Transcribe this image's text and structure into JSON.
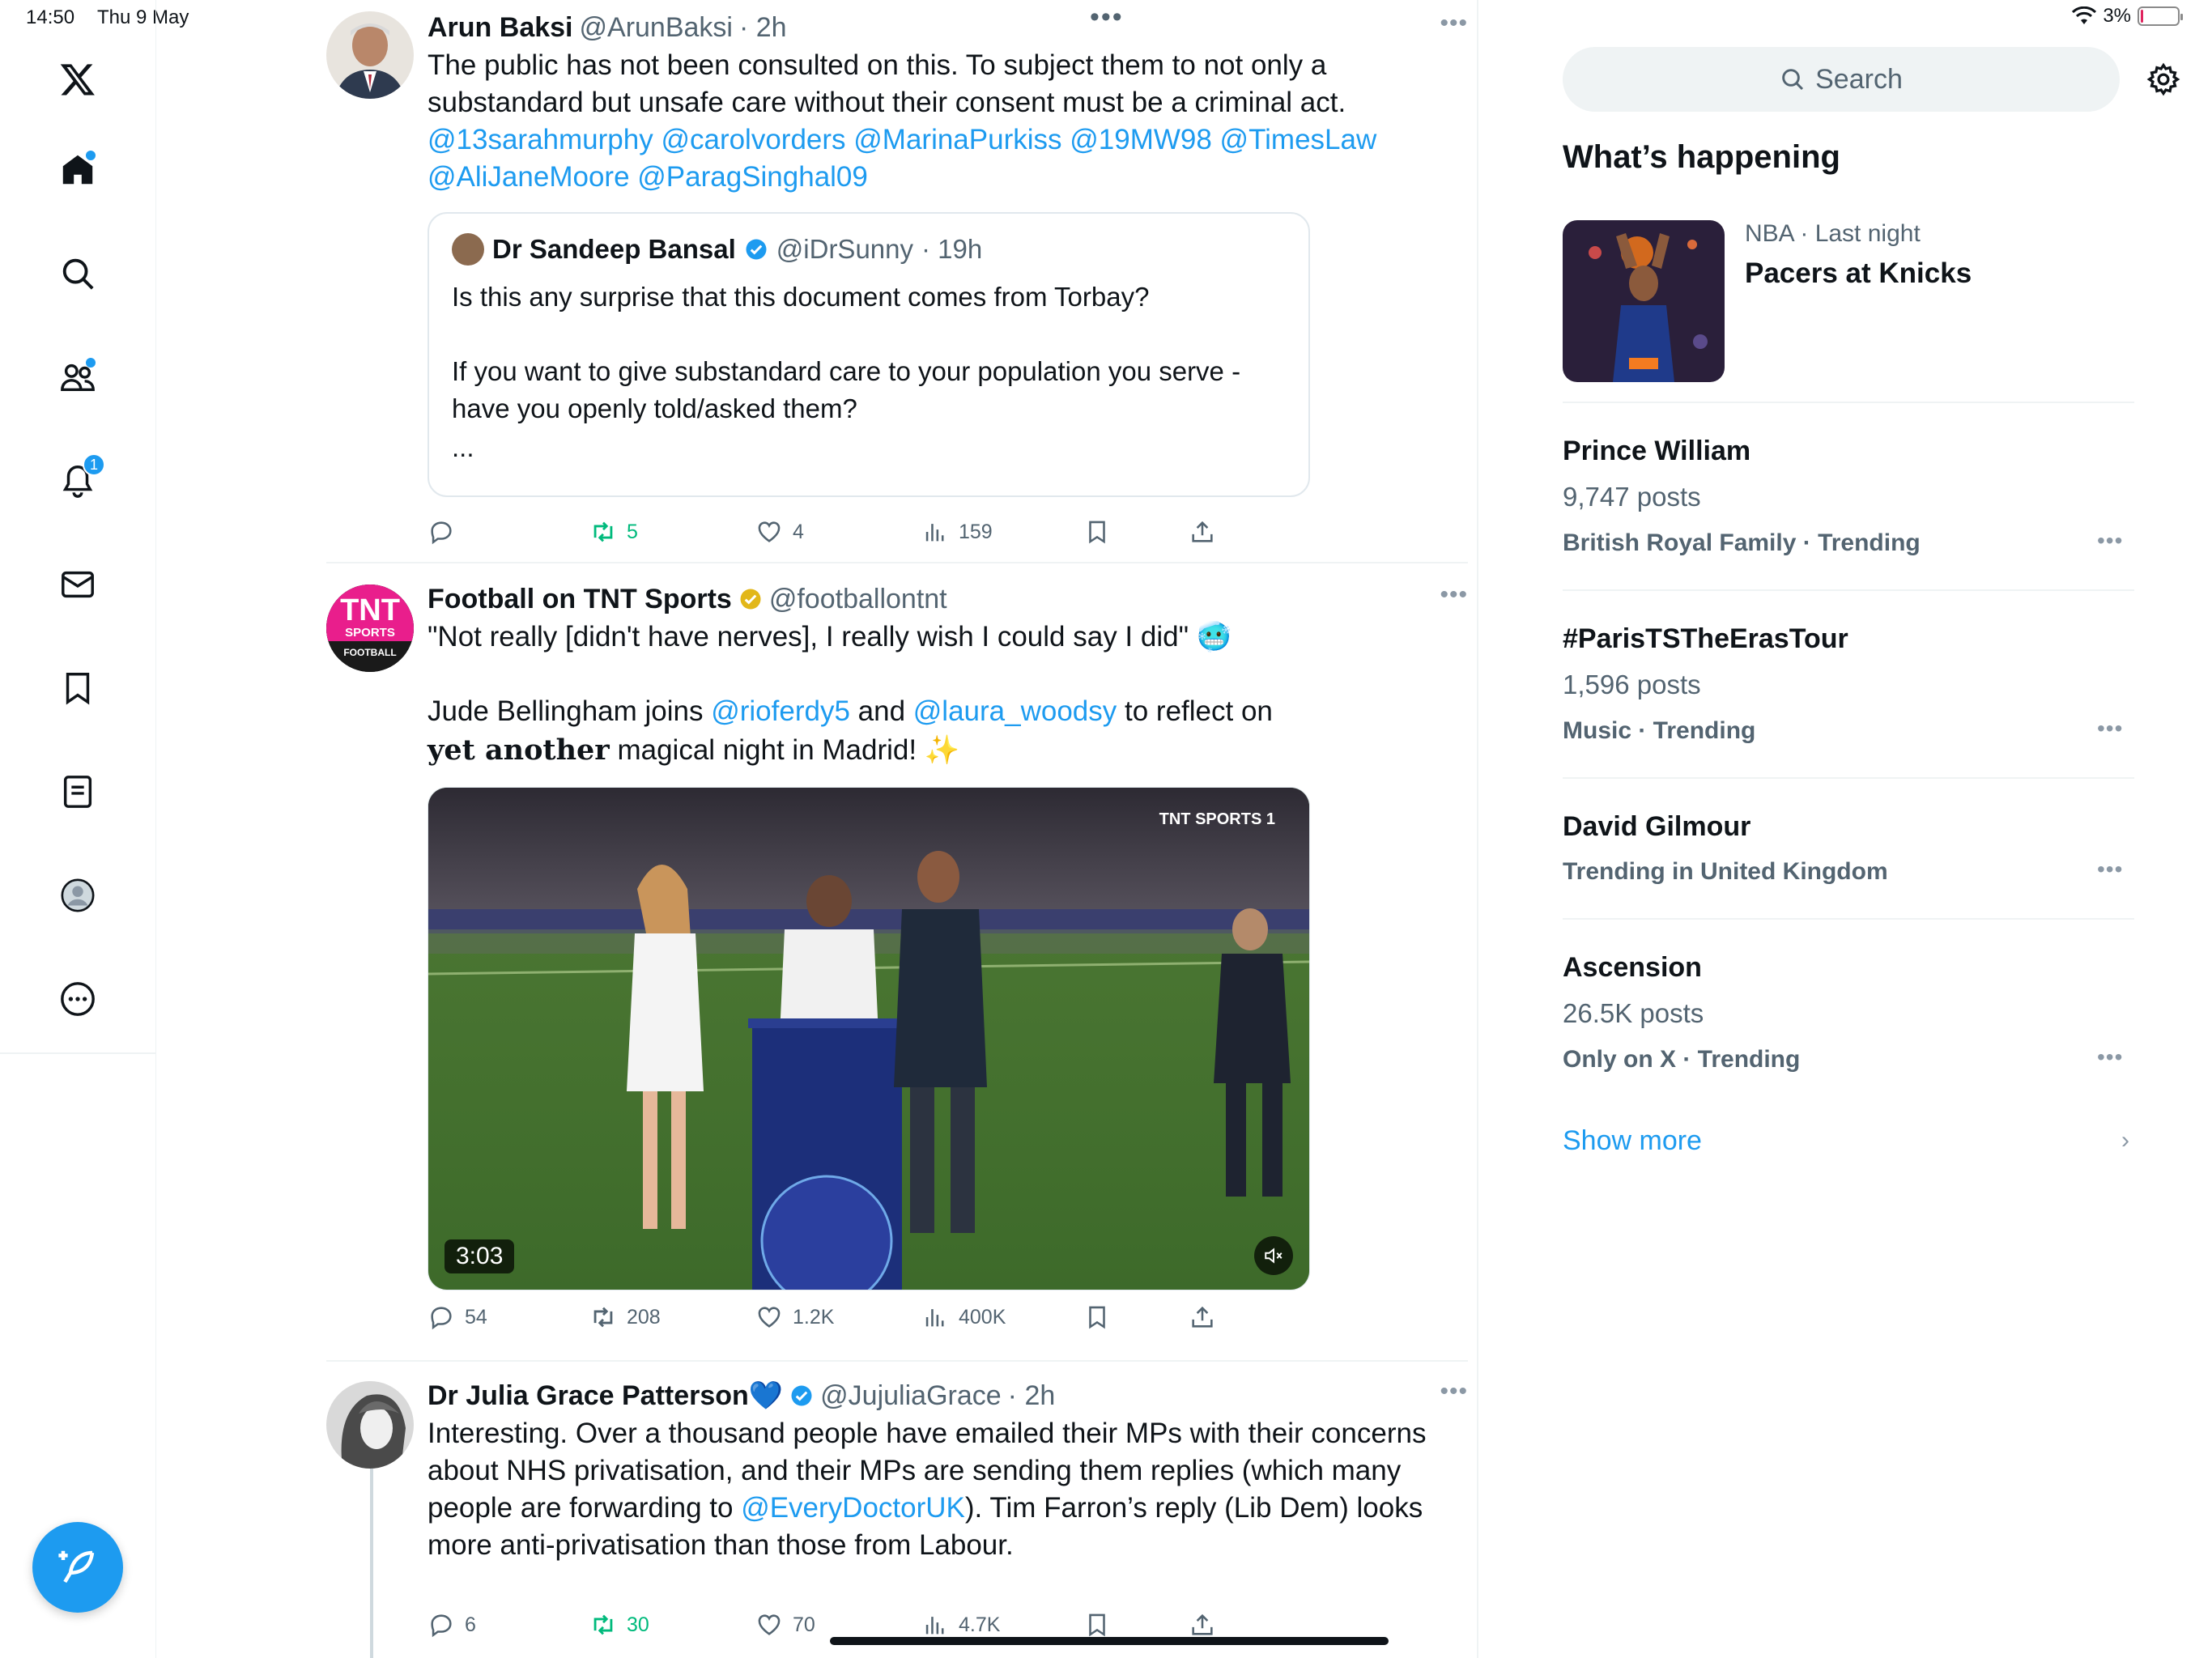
{
  "status": {
    "time": "14:50",
    "date": "Thu 9 May",
    "battery": "3%",
    "battery_level": 0.03
  },
  "nav": {
    "notifications_badge": "1"
  },
  "feed": {
    "tweets": [
      {
        "name": "Arun Baksi",
        "handle": "@ArunBaksi",
        "time": "· 2h",
        "text": "The public has not been consulted on this. To subject them to not only a substandard but unsafe care without their consent must be a criminal act.",
        "mentions": "@13sarahmurphy @carolvorders @MarinaPurkiss @19MW98 @TimesLaw @AliJaneMoore @ParagSinghal09",
        "quote": {
          "name": "Dr Sandeep Bansal",
          "handle": "@iDrSunny",
          "time": "· 19h",
          "line1": "Is this any surprise that this document comes from Torbay?",
          "line2": "If you want to give substandard care to your population you serve - have you openly told/asked them?",
          "line3": "..."
        },
        "replies": "",
        "retweets": "5",
        "likes": "4",
        "views": "159"
      },
      {
        "name": "Football on TNT Sports",
        "handle": "@footballontnt",
        "line1": "\"Not really [didn't have nerves], I really wish I could say I did\" 🥶",
        "line2_a": "Jude Bellingham joins ",
        "mention1": "@rioferdy5",
        "line2_b": " and ",
        "mention2": "@laura_woodsy",
        "line2_c": " to reflect on",
        "line3_bold": "𝐲𝐞𝐭 𝐚𝐧𝐨𝐭𝐡𝐞𝐫",
        "line3_rest": " magical night in Madrid! ✨",
        "video_duration": "3:03",
        "broadcaster": "TNT SPORTS 1",
        "avatar_text": "TNT",
        "avatar_sub1": "SPORTS",
        "avatar_sub2": "FOOTBALL",
        "replies": "54",
        "retweets": "208",
        "likes": "1.2K",
        "views": "400K"
      },
      {
        "name": "Dr Julia Grace Patterson💙",
        "handle": "@JujuliaGrace",
        "time": "· 2h",
        "text_a": "Interesting. Over a thousand people have emailed their MPs with their concerns about NHS privatisation, and their MPs are sending them replies (which many people are forwarding to ",
        "mention": "@EveryDoctorUK",
        "text_b": "). Tim Farron’s reply (Lib Dem) looks more anti-privatisation than those from Labour.",
        "replies": "6",
        "retweets": "30",
        "likes": "70",
        "views": "4.7K"
      }
    ]
  },
  "sidebar": {
    "search_placeholder": "Search",
    "title": "What’s happening",
    "featured": {
      "meta": "NBA · Last night",
      "title": "Pacers at Knicks"
    },
    "trends": [
      {
        "name": "Prince William",
        "posts": "9,747 posts",
        "category": "British Royal Family · Trending"
      },
      {
        "name": "#ParisTSTheErasTour",
        "posts": "1,596 posts",
        "category": "Music · Trending"
      },
      {
        "name": "David Gilmour",
        "posts": "",
        "category": "Trending in United Kingdom"
      },
      {
        "name": "Ascension",
        "posts": "26.5K posts",
        "category": "Only on X · Trending"
      }
    ],
    "show_more": "Show more"
  },
  "colors": {
    "accent": "#1d9bf0",
    "retweet_green": "#00ba7c",
    "muted_text": "#536471"
  }
}
